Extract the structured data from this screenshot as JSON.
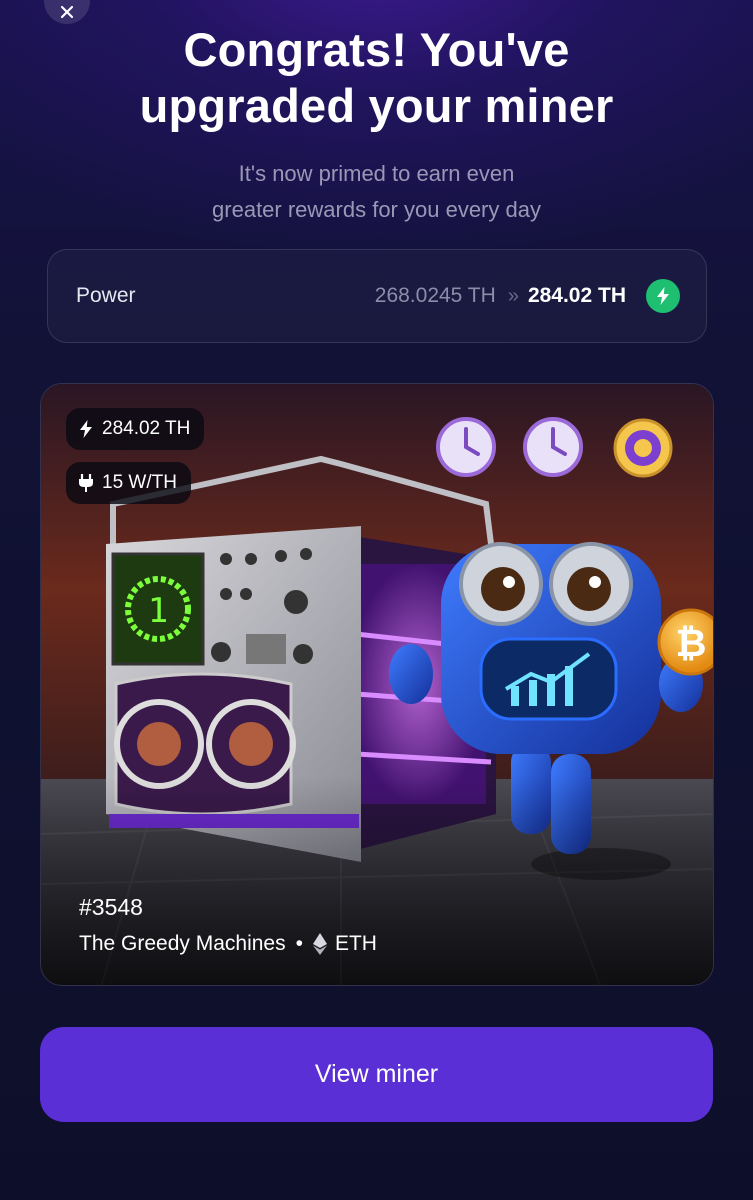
{
  "header": {
    "title_line1": "Congrats! You've",
    "title_line2": "upgraded your miner",
    "subtitle_line1": "It's now primed to earn even",
    "subtitle_line2": "greater rewards for you every day"
  },
  "power": {
    "label": "Power",
    "old_value": "268.0245 TH",
    "arrow": "»",
    "new_value": "284.02 TH",
    "badge_icon": "bolt-icon",
    "badge_color": "#1fbf72"
  },
  "nft": {
    "power_stat": "284.02 TH",
    "efficiency_stat": "15 W/TH",
    "id": "#3548",
    "collection": "The Greedy Machines",
    "separator": "•",
    "chain": "ETH",
    "image_description": "robot-miner-artwork"
  },
  "cta": {
    "label": "View miner",
    "color": "#5a2fd6"
  },
  "icons": [
    "close-icon",
    "bolt-icon",
    "plug-icon",
    "ethereum-icon"
  ]
}
